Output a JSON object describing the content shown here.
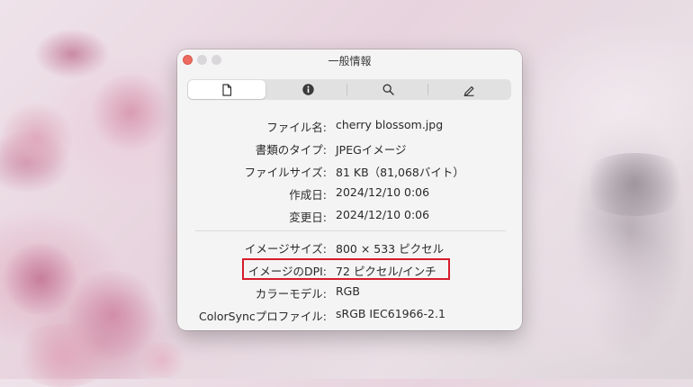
{
  "window": {
    "title": "一般情報"
  },
  "toolbar": {
    "tabs": [
      {
        "icon": "document-icon",
        "active": true
      },
      {
        "icon": "info-icon",
        "active": false
      },
      {
        "icon": "magnifier-icon",
        "active": false
      },
      {
        "icon": "pencil-icon",
        "active": false
      }
    ]
  },
  "info": {
    "filename": {
      "label": "ファイル名:",
      "value": "cherry blossom.jpg"
    },
    "kind": {
      "label": "書類のタイプ:",
      "value": "JPEGイメージ"
    },
    "size": {
      "label": "ファイルサイズ:",
      "value": "81 KB（81,068バイト）"
    },
    "created": {
      "label": "作成日:",
      "value": "2024/12/10 0:06"
    },
    "modified": {
      "label": "変更日:",
      "value": "2024/12/10 0:06"
    },
    "dimensions": {
      "label": "イメージサイズ:",
      "value": "800 × 533 ピクセル"
    },
    "dpi": {
      "label": "イメージのDPI:",
      "value": "72 ピクセル/インチ"
    },
    "color_model": {
      "label": "カラーモデル:",
      "value": "RGB"
    },
    "colorsync": {
      "label": "ColorSyncプロファイル:",
      "value": "sRGB IEC61966-2.1"
    }
  },
  "colors": {
    "highlight": "#d51d2b",
    "close_button": "#ed6a5e",
    "window_bg": "#f5f4f5"
  }
}
